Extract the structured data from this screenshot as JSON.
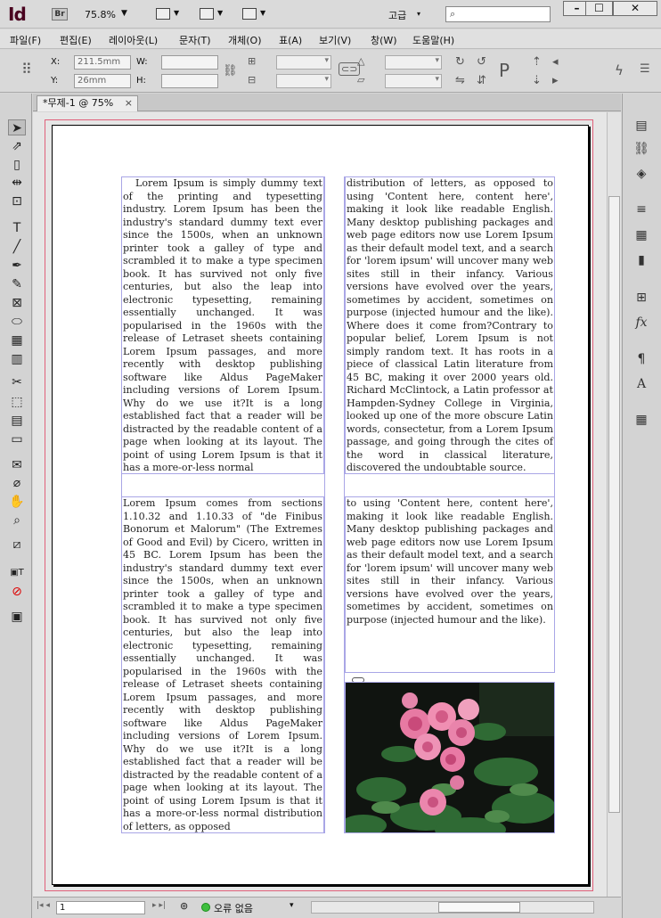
{
  "titlebar": {
    "app_logo": "Id",
    "bridge_label": "Br",
    "zoom": "75.8%",
    "workspace": "고급",
    "minimize": "–",
    "maximize": "☐",
    "close": "✕"
  },
  "menu": [
    "파일(F)",
    "편집(E)",
    "레이아웃(L)",
    "문자(T)",
    "개체(O)",
    "표(A)",
    "보기(V)",
    "창(W)",
    "도움말(H)"
  ],
  "control": {
    "x_label": "X:",
    "x_value": "211.5mm",
    "y_label": "Y:",
    "y_value": "26mm",
    "w_label": "W:",
    "h_label": "H:"
  },
  "document": {
    "tab_title": "*무제-1 @ 75%",
    "tab_close": "×",
    "frame_a": "Lorem Ipsum is simply dummy text of the printing and typesetting industry. Lorem Ipsum has been the industry's standard dummy text ever since the 1500s, when an unknown printer took a galley of type and scrambled it to make a type specimen book. It has survived not only five centuries, but also the leap into electronic typesetting, remaining essentially unchanged. It was popularised in the 1960s with the release of Letraset sheets containing Lorem Ipsum passages, and more recently with desktop publishing software like Aldus PageMaker including versions of Lorem Ipsum. Why do we use it?It is a long established fact that a reader will be distracted by the readable content of a page when looking at its layout. The point of using Lorem Ipsum is that it has a more-or-less normal",
    "frame_b": "distribution of letters, as opposed to using 'Content here, content here', making it look like readable English. Many desktop publishing packages and web page editors now use Lorem Ipsum as their default model text, and a search for 'lorem ipsum' will uncover many web sites still in their infancy. Various versions have evolved over the years, sometimes by accident, sometimes on purpose (injected humour and the like). Where does it come from?Contrary to popular belief, Lorem Ipsum is not simply random text. It has roots in a piece of classical Latin literature from 45 BC, making it over 2000 years old. Richard McClintock, a Latin professor at Hampden-Sydney College in Virginia, looked up one of the more obscure Latin words, consectetur, from a Lorem Ipsum passage, and going through the cites of the word in classical literature, discovered the undoubtable source.",
    "frame_c": "Lorem Ipsum comes from sections 1.10.32 and 1.10.33 of \"de Finibus Bonorum et Malorum\" (The Extremes of Good and Evil) by Cicero, written in 45 BC. Lorem Ipsum has been the industry's standard dummy text ever since the 1500s, when an unknown printer took a galley of type and scrambled it to make a type specimen book. It has survived not only five centuries, but also the leap into electronic typesetting, remaining essentially unchanged. It was popularised in the 1960s with the release of Letraset sheets containing Lorem Ipsum passages, and more recently with desktop publishing software like Aldus PageMaker including versions of Lorem Ipsum. Why do we use it?It is a long established fact that a reader will be distracted by the readable content of a page when looking at its layout. The point of using Lorem Ipsum is that it has a more-or-less normal distribution of letters, as opposed",
    "frame_d": "to using 'Content here, content here', making it look like readable English. Many desktop publishing packages and web page editors now use Lorem Ipsum as their default model text, and a search for 'lorem ipsum' will uncover many web sites still in their infancy. Various versions have evolved over the years, sometimes by accident, sometimes on purpose (injected humour and the like)."
  },
  "status": {
    "page_number": "1",
    "preflight_text": "오류 없음"
  },
  "colors": {
    "margin_guide": "#e0607a",
    "frame_edge": "#a9a6e6",
    "preflight_ok": "#3fbf3f"
  }
}
